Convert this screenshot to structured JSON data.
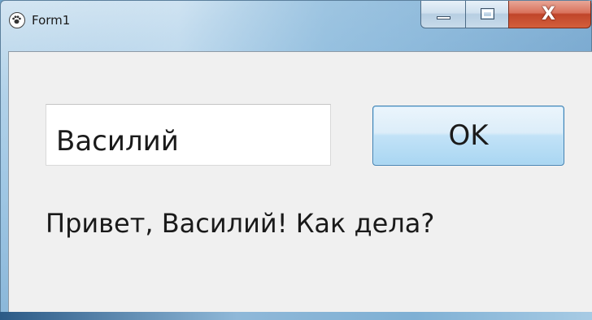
{
  "window": {
    "title": "Form1",
    "icon": "paw-icon",
    "caption": {
      "minimize_icon": "minimize-icon",
      "maximize_icon": "maximize-icon",
      "close_icon": "close-icon",
      "close_glyph": "X"
    }
  },
  "form": {
    "name_input_value": "Василий",
    "ok_label": "OK",
    "greeting_text": "Привет, Василий! Как дела?"
  },
  "colors": {
    "client_background": "#f0f0f0",
    "button_border": "#3c7fb1",
    "close_button": "#c0452a"
  }
}
